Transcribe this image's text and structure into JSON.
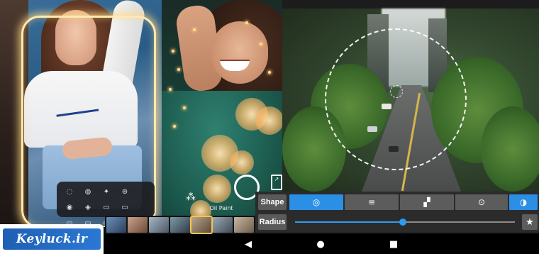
{
  "watermark": {
    "text": "Keyluck.ir"
  },
  "filter_label": "Oil Paint",
  "editor": {
    "shape_label": "Shape",
    "radius_label": "Radius",
    "shape_options": [
      {
        "icon": "target-icon",
        "glyph": "◎",
        "active": true
      },
      {
        "icon": "lines-icon",
        "glyph": "≡",
        "active": false
      },
      {
        "icon": "pixel-grid-icon",
        "glyph": "▞",
        "active": false
      },
      {
        "icon": "radio-dot-icon",
        "glyph": "⊙",
        "active": false
      },
      {
        "icon": "half-circle-icon",
        "glyph": "◑",
        "active": true
      }
    ],
    "radius_value": 0.49,
    "star_glyph": "★"
  },
  "tool_menu_glyphs": [
    "◌",
    "◍",
    "✦",
    "⊛",
    "◉",
    "◈",
    "▭",
    "▭",
    "▭",
    "▭",
    "▭",
    "▭"
  ],
  "nav": {
    "back": "◀",
    "home": "●",
    "recents": "■"
  },
  "colors": {
    "accent": "#2a8fe5",
    "panel": "#2b2b2b",
    "button": "#5c5c5c",
    "watermark_blue": "#1f5fb4"
  }
}
